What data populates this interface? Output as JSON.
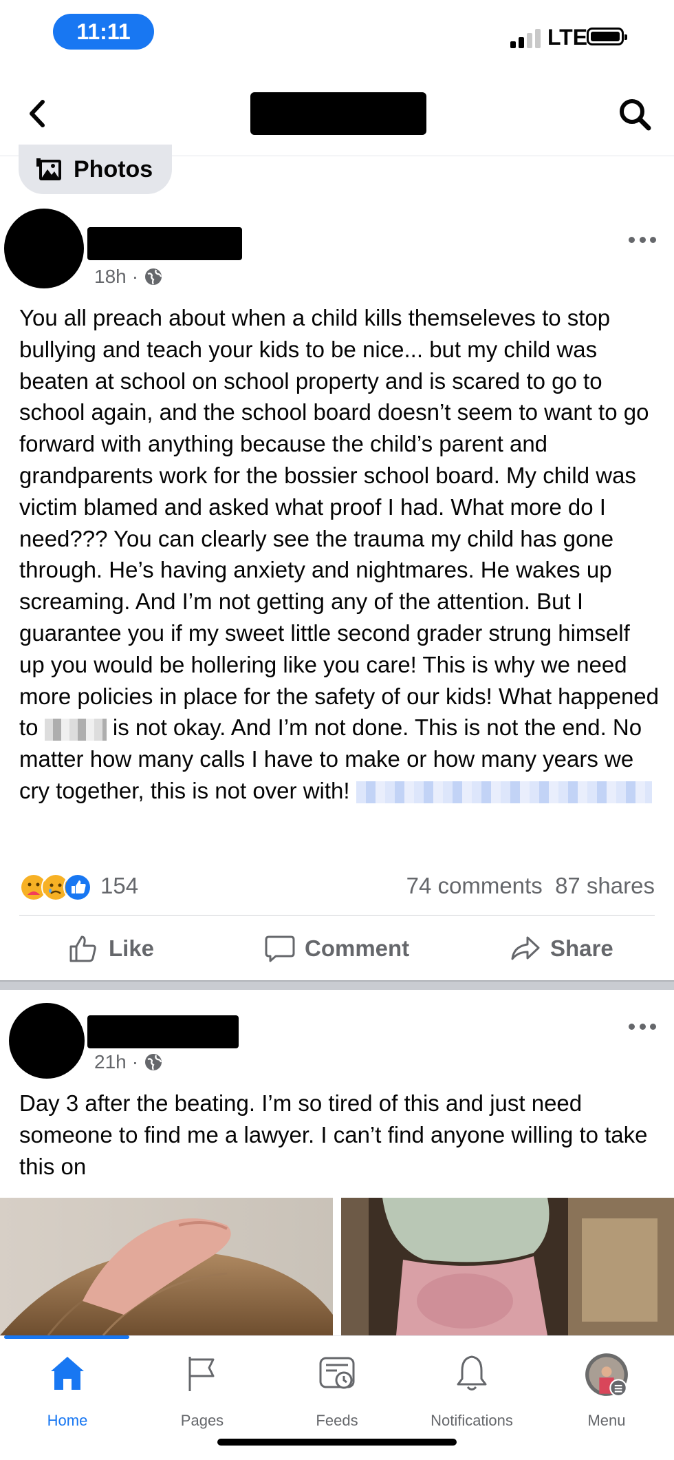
{
  "status_bar": {
    "time": "11:11",
    "network": "LTE"
  },
  "header": {
    "back_icon": "chevron-left-icon",
    "search_icon": "search-icon"
  },
  "photos_chip": {
    "label": "Photos",
    "icon": "photo-album-icon"
  },
  "post1": {
    "time": "18h",
    "audience_icon": "globe-icon",
    "text_before_name": "You all preach about when a child kills themseleves to stop bullying and teach your kids to be nice... but my child was beaten at school on school property and is scared to go to school again, and the school board doesn’t seem to want to go forward with anything because the child’s parent and grandparents work for the bossier school board. My child was victim blamed and asked what proof I had. What more do I need??? You can clearly see the trauma my child has gone through. He’s having anxiety and nightmares. He wakes up screaming. And I’m not getting any of the attention. But I guarantee you if my sweet little second grader strung himself up you would be hollering like you care! This is why we need more policies in place for the safety of our kids! What happened to ",
    "text_after_name": " is not okay. And I’m not done. This is not the end. No matter how many calls I have to make or how many years we cry together, this is not over with! ",
    "reaction_count": "154",
    "comments": "74 comments",
    "shares": "87 shares",
    "actions": {
      "like": "Like",
      "comment": "Comment",
      "share": "Share"
    }
  },
  "post2": {
    "time": "21h",
    "audience_icon": "globe-icon",
    "text": "Day 3 after the beating. I’m so tired of this and just need someone to find me a lawyer. I can’t find anyone willing to take this on"
  },
  "bottom_nav": [
    {
      "label": "Home",
      "icon": "home-icon",
      "active": true
    },
    {
      "label": "Pages",
      "icon": "flag-icon",
      "active": false
    },
    {
      "label": "Feeds",
      "icon": "feeds-icon",
      "active": false
    },
    {
      "label": "Notifications",
      "icon": "bell-icon",
      "active": false
    },
    {
      "label": "Menu",
      "icon": "profile-avatar-icon",
      "active": false
    }
  ],
  "colors": {
    "accent": "#1877f2",
    "secondary_text": "#65676b",
    "divider": "#ced0d4"
  }
}
